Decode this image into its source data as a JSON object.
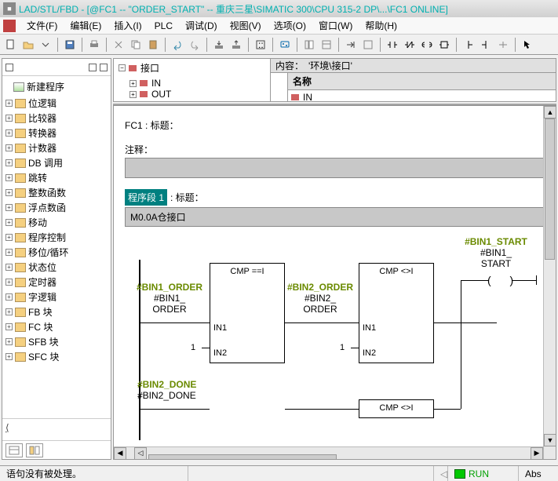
{
  "title": "LAD/STL/FBD  - [@FC1 -- \"ORDER_START\" -- 重庆三星\\SIMATIC 300\\CPU 315-2 DP\\...\\FC1  ONLINE]",
  "menu": {
    "file": "文件(F)",
    "edit": "编辑(E)",
    "insert": "插入(I)",
    "plc": "PLC",
    "debug": "调试(D)",
    "view": "视图(V)",
    "options": "选项(O)",
    "window": "窗口(W)",
    "help": "帮助(H)"
  },
  "tree": {
    "root": "新建程序",
    "items": [
      "位逻辑",
      "比较器",
      "转换器",
      "计数器",
      "DB 调用",
      "跳转",
      "整数函数",
      "浮点数函",
      "移动",
      "程序控制",
      "移位/循环",
      "状态位",
      "定时器",
      "字逻辑",
      "FB 块",
      "FC 块",
      "SFB 块",
      "SFC 块"
    ]
  },
  "interface": {
    "content_label": "内容：",
    "content_value": "'环境\\接口'",
    "root": "接口",
    "in": "IN",
    "out": "OUT",
    "name_header": "名称",
    "name_in": "IN"
  },
  "editor": {
    "fc_title": "FC1 : 标题：",
    "comment_label": "注释：",
    "segment_badge": "程序段 1",
    "segment_title": ": 标题：",
    "segment_comment": "M0.0A仓接口"
  },
  "ladder": {
    "cmp_eq": "CMP ==I",
    "cmp_ne": "CMP <>I",
    "in1": "IN1",
    "in2": "IN2",
    "one": "1",
    "bin1_order": "#BIN1_ORDER",
    "bin1_order_sub": "#BIN1_ORDER",
    "bin2_order": "#BIN2_ORDER",
    "bin2_order_sub": "#BIN2_ORDER",
    "bin2_done": "#BIN2_DONE",
    "bin2_done_sub": "#BIN2_DONE",
    "bin1_start": "#BIN1_START",
    "bin1_start_sub": "#BIN1_START",
    "coil": "(  )"
  },
  "status": {
    "msg": "语句没有被处理。",
    "offline_marker": "◁",
    "run": "RUN",
    "abs": "Abs"
  }
}
